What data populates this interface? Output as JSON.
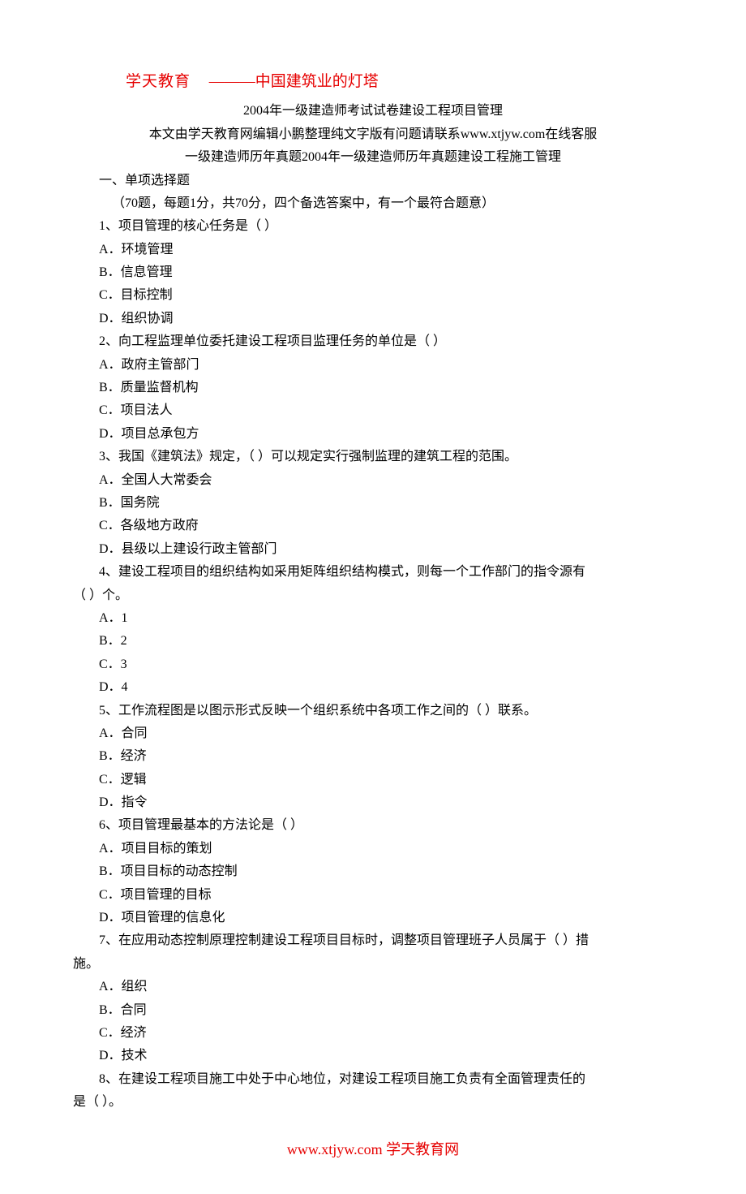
{
  "header": {
    "brand": "学天教育",
    "tagline": "———中国建筑业的灯塔"
  },
  "title": "2004年一级建造师考试试卷建设工程项目管理",
  "subtitle1": "本文由学天教育网编辑小鹏整理纯文字版有问题请联系www.xtjyw.com在线客服",
  "subtitle2": "一级建造师历年真题2004年一级建造师历年真题建设工程施工管理",
  "section1": {
    "heading": "一、单项选择题",
    "hint": "（70题，每题1分，共70分，四个备选答案中，有一个最符合题意）",
    "q1": {
      "stem": "1、项目管理的核心任务是（ ）",
      "a": "A．环境管理",
      "b": "B．信息管理",
      "c": "C．目标控制",
      "d": "D．组织协调"
    },
    "q2": {
      "stem": "2、向工程监理单位委托建设工程项目监理任务的单位是（ ）",
      "a": "A．政府主管部门",
      "b": "B．质量监督机构",
      "c": "C．项目法人",
      "d": "D．项目总承包方"
    },
    "q3": {
      "stem": "3、我国《建筑法》规定，（ ）可以规定实行强制监理的建筑工程的范围。",
      "a": "A．全国人大常委会",
      "b": "B．国务院",
      "c": "C．各级地方政府",
      "d": "D．县级以上建设行政主管部门"
    },
    "q4": {
      "stem_l1": "4、建设工程项目的组织结构如采用矩阵组织结构模式，则每一个工作部门的指令源有",
      "stem_l2": "（ ）个。",
      "a": "A．1",
      "b": "B．2",
      "c": "C．3",
      "d": "D．4"
    },
    "q5": {
      "stem": "5、工作流程图是以图示形式反映一个组织系统中各项工作之间的（ ）联系。",
      "a": "A．合同",
      "b": "B．经济",
      "c": "C．逻辑",
      "d": "D．指令"
    },
    "q6": {
      "stem": "6、项目管理最基本的方法论是（ ）",
      "a": "A．项目目标的策划",
      "b": "B．项目目标的动态控制",
      "c": "C．项目管理的目标",
      "d": "D．项目管理的信息化"
    },
    "q7": {
      "stem_l1": "7、在应用动态控制原理控制建设工程项目目标时，调整项目管理班子人员属于（ ）措",
      "stem_l2": "施。",
      "a": "A．组织",
      "b": "B．合同",
      "c": "C．经济",
      "d": "D．技术"
    },
    "q8": {
      "stem_l1": "8、在建设工程项目施工中处于中心地位，对建设工程项目施工负责有全面管理责任的",
      "stem_l2": "是（ ）。"
    }
  },
  "footer": "www.xtjyw.com 学天教育网"
}
